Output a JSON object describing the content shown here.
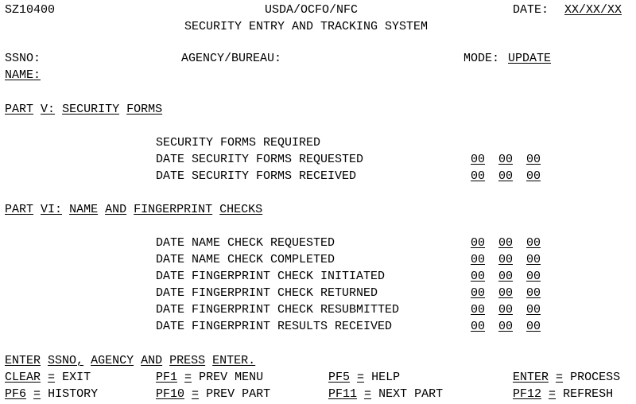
{
  "screen": {
    "program_id": "SZ10400",
    "org_title": "USDA/OCFO/NFC",
    "system_title": "SECURITY ENTRY AND TRACKING SYSTEM",
    "date_label": "DATE:",
    "date_value": "XX/XX/XX",
    "background_color": "#ffffff",
    "text_color": "#000000"
  },
  "identity": {
    "ssno_label": "SSNO:",
    "ssno_value": "",
    "agency_label": "AGENCY/BUREAU:",
    "agency_value": "",
    "mode_label": "MODE:",
    "mode_value": "UPDATE",
    "name_label": "NAME:",
    "name_value": ""
  },
  "part_v": {
    "heading_tokens": [
      "PART",
      "V:",
      "SECURITY",
      "FORMS"
    ],
    "heading": "PART V: SECURITY FORMS",
    "fields": [
      {
        "label": "SECURITY FORMS REQUIRED",
        "has_value": false,
        "value": [
          "",
          "",
          ""
        ]
      },
      {
        "label": "DATE SECURITY FORMS REQUESTED",
        "has_value": true,
        "value": [
          "00",
          "00",
          "00"
        ]
      },
      {
        "label": "DATE SECURITY FORMS RECEIVED",
        "has_value": true,
        "value": [
          "00",
          "00",
          "00"
        ]
      }
    ]
  },
  "part_vi": {
    "heading_tokens": [
      "PART",
      "VI:",
      "NAME",
      "AND",
      "FINGERPRINT",
      "CHECKS"
    ],
    "heading": "PART VI: NAME AND FINGERPRINT CHECKS",
    "fields": [
      {
        "label": "DATE NAME CHECK REQUESTED",
        "has_value": true,
        "value": [
          "00",
          "00",
          "00"
        ]
      },
      {
        "label": "DATE NAME CHECK COMPLETED",
        "has_value": true,
        "value": [
          "00",
          "00",
          "00"
        ]
      },
      {
        "label": "DATE FINGERPRINT CHECK INITIATED",
        "has_value": true,
        "value": [
          "00",
          "00",
          "00"
        ]
      },
      {
        "label": "DATE FINGERPRINT CHECK RETURNED",
        "has_value": true,
        "value": [
          "00",
          "00",
          "00"
        ]
      },
      {
        "label": "DATE FINGERPRINT CHECK RESUBMITTED",
        "has_value": true,
        "value": [
          "00",
          "00",
          "00"
        ]
      },
      {
        "label": "DATE FINGERPRINT RESULTS RECEIVED",
        "has_value": true,
        "value": [
          "00",
          "00",
          "00"
        ]
      }
    ]
  },
  "footer": {
    "instruction_tokens": [
      "ENTER",
      "SSNO,",
      "AGENCY",
      "AND",
      "PRESS",
      "ENTER."
    ],
    "instruction": "ENTER SSNO, AGENCY AND PRESS ENTER.",
    "keys": [
      {
        "key": "CLEAR",
        "eq": "=",
        "action": "EXIT",
        "col": 0,
        "row": 1
      },
      {
        "key": "PF1",
        "eq": "=",
        "action": "PREV MENU",
        "col": 19,
        "row": 1
      },
      {
        "key": "PF5",
        "eq": "=",
        "action": "HELP",
        "col": 40,
        "row": 1
      },
      {
        "key": "ENTER",
        "eq": "=",
        "action": "PROCESS",
        "col": 63,
        "row": 1
      },
      {
        "key": "PF6",
        "eq": "=",
        "action": "HISTORY",
        "col": 0,
        "row": 2
      },
      {
        "key": "PF10",
        "eq": "=",
        "action": "PREV PART",
        "col": 19,
        "row": 2
      },
      {
        "key": "PF11",
        "eq": "=",
        "action": "NEXT PART",
        "col": 40,
        "row": 2
      },
      {
        "key": "PF12",
        "eq": "=",
        "action": "REFRESH",
        "col": 63,
        "row": 2
      }
    ]
  }
}
